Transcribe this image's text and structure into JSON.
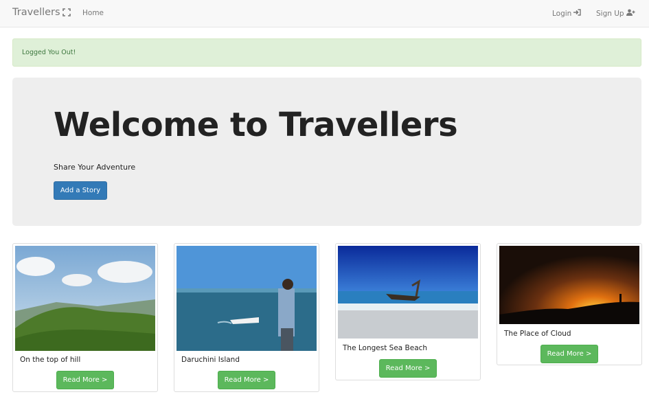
{
  "navbar": {
    "brand": "Travellers",
    "home": "Home",
    "login": "Login",
    "signup": "Sign Up"
  },
  "alert": {
    "message": "Logged You Out!"
  },
  "jumbotron": {
    "title": "Welcome to Travellers",
    "subtitle": "Share Your Adventure",
    "button": "Add a Story"
  },
  "stories": [
    {
      "title": "On the top of hill",
      "button": "Read More >"
    },
    {
      "title": "Daruchini Island",
      "button": "Read More >"
    },
    {
      "title": "The Longest Sea Beach",
      "button": "Read More >"
    },
    {
      "title": "The Place of Cloud",
      "button": "Read More >"
    }
  ],
  "colors": {
    "primary": "#337ab7",
    "success": "#5cb85c",
    "alert_bg": "#dff0d8",
    "alert_text": "#3c763d",
    "jumbotron_bg": "#eeeeee"
  }
}
